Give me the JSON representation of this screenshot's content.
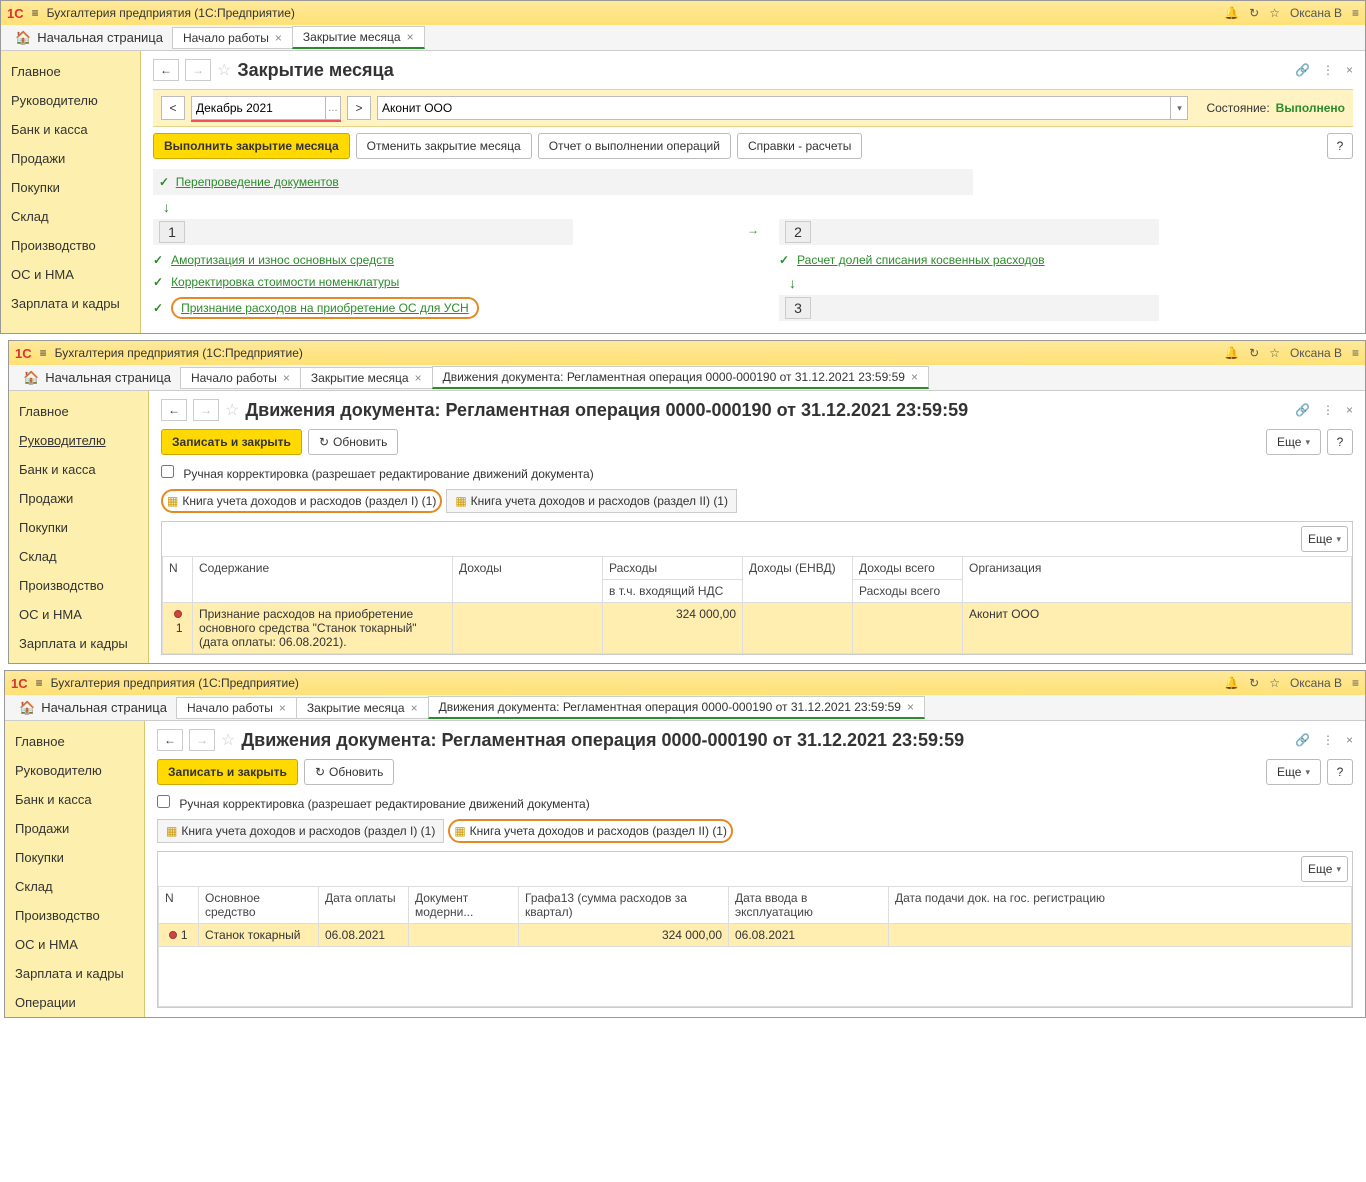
{
  "titlebar": {
    "app": "Бухгалтерия предприятия  (1С:Предприятие)",
    "user": "Оксана В",
    "logo": "1C"
  },
  "tabs_home": "Начальная страница",
  "tabs_common": [
    {
      "label": "Начало работы"
    },
    {
      "label": "Закрытие месяца"
    }
  ],
  "tabs_doc": {
    "label": "Движения документа: Регламентная операция 0000-000190 от 31.12.2021 23:59:59"
  },
  "sidebar": [
    "Главное",
    "Руководителю",
    "Банк и касса",
    "Продажи",
    "Покупки",
    "Склад",
    "Производство",
    "ОС и НМА",
    "Зарплата и кадры",
    "Операции"
  ],
  "win1": {
    "title": "Закрытие месяца",
    "period": "Декабрь 2021",
    "org": "Аконит ООО",
    "status_label": "Состояние:",
    "status_value": "Выполнено",
    "btn_execute": "Выполнить закрытие месяца",
    "btn_cancel": "Отменить закрытие месяца",
    "btn_report": "Отчет о выполнении операций",
    "btn_refs": "Справки - расчеты",
    "op_repost": "Перепроведение документов",
    "num1": "1",
    "op_amort": "Амортизация и износ основных средств",
    "op_corr": "Корректировка стоимости номенклатуры",
    "op_recog": "Признание расходов на приобретение ОС для УСН",
    "num2": "2",
    "op_share": "Расчет долей списания косвенных расходов",
    "num3": "3"
  },
  "win2": {
    "title": "Движения документа: Регламентная операция 0000-000190 от 31.12.2021 23:59:59",
    "btn_save": "Записать и закрыть",
    "btn_refresh": "Обновить",
    "btn_more": "Еще",
    "cb_label": "Ручная корректировка (разрешает редактирование движений документа)",
    "tab_r1": "Книга учета доходов и расходов (раздел I) (1)",
    "tab_r2": "Книга учета доходов и расходов (раздел II) (1)",
    "headers": {
      "n": "N",
      "content": "Содержание",
      "income": "Доходы",
      "expense": "Расходы",
      "expense_sub": "в т.ч. входящий НДС",
      "income_envd": "Доходы (ЕНВД)",
      "income_total": "Доходы всего",
      "income_total_sub": "Расходы всего",
      "org": "Организация"
    },
    "row": {
      "n": "1",
      "content": "Признание расходов на приобретение основного средства \"Станок токарный\" (дата оплаты: 06.08.2021).",
      "expense": "324 000,00",
      "org": "Аконит ООО"
    }
  },
  "win3": {
    "headers": {
      "n": "N",
      "asset": "Основное средство",
      "pay_date": "Дата оплаты",
      "mod_doc": "Документ модерни...",
      "col13": "Графа13 (сумма расходов за квартал)",
      "commission": "Дата ввода в эксплуатацию",
      "reg_date": "Дата подачи док. на гос. регистрацию"
    },
    "row": {
      "n": "1",
      "asset": "Станок токарный",
      "pay_date": "06.08.2021",
      "amount": "324 000,00",
      "commission": "06.08.2021"
    }
  }
}
